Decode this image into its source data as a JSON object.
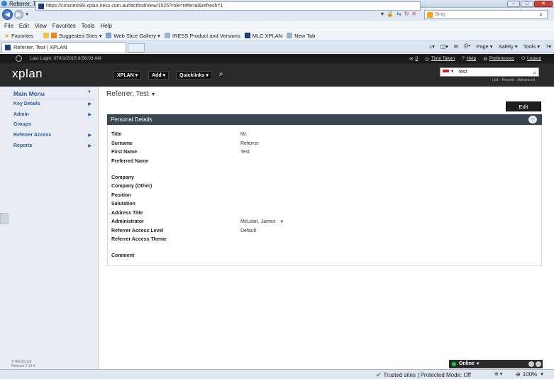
{
  "window": {
    "title": "Referrer, Test | XPLAN - Windows Internet Explorer"
  },
  "browser": {
    "url": "https://conxtest99.xplan.iress.com.au/factfind/view/1525?role=referral&refresh=1",
    "search_placeholder": "Bing",
    "menu": [
      "File",
      "Edit",
      "View",
      "Favorites",
      "Tools",
      "Help"
    ],
    "favorites": [
      "Favorites",
      "Suggested Sites ▾",
      "Web Slice Gallery ▾",
      "IRESS Product and Versions",
      "MLC XPLAN",
      "New Tab"
    ],
    "tab_title": "Referrer, Test | XPLAN",
    "command_bar": [
      "Page ▾",
      "Safety ▾",
      "Tools ▾"
    ]
  },
  "xplan": {
    "last_login": "Last Login: 07/01/2015 8:56:03 AM",
    "top_links": {
      "messages": "0",
      "time_taken": "Time Taken",
      "help": "Help",
      "preferences": "Preferences",
      "logout": "Logout"
    },
    "logo": "xplan",
    "nav": [
      "XPLAN",
      "Add",
      "Quicklinks"
    ],
    "search_value": "test",
    "search_sublinks": "List · Recent · Advanced"
  },
  "sidebar": {
    "items": [
      "Main Menu",
      "Key Details",
      "Admin",
      "Groups",
      "Referrer Access",
      "Reports"
    ],
    "footer_line1": "© IRESS Ltd",
    "footer_line2": "Release 2.12.4"
  },
  "main": {
    "title": "Referrer, Test",
    "edit_label": "Edit",
    "panel_title": "Personal Details",
    "fields": [
      {
        "label": "Title",
        "value": "Mr."
      },
      {
        "label": "Surname",
        "value": "Referrer"
      },
      {
        "label": "First Name",
        "value": "Test"
      },
      {
        "label": "Preferred Name",
        "value": ""
      },
      {
        "label": "Company",
        "value": ""
      },
      {
        "label": "Company (Other)",
        "value": ""
      },
      {
        "label": "Position",
        "value": ""
      },
      {
        "label": "Salutation",
        "value": ""
      },
      {
        "label": "Address Title",
        "value": ""
      },
      {
        "label": "Administrator",
        "value": "McLean, James"
      },
      {
        "label": "Referrer Access Level",
        "value": "Default"
      },
      {
        "label": "Referrer Access Theme",
        "value": ""
      },
      {
        "label": "Comment",
        "value": ""
      }
    ]
  },
  "status": {
    "online": "Online",
    "trusted": "Trusted sites | Protected Mode: Off",
    "zoom": "100%"
  }
}
